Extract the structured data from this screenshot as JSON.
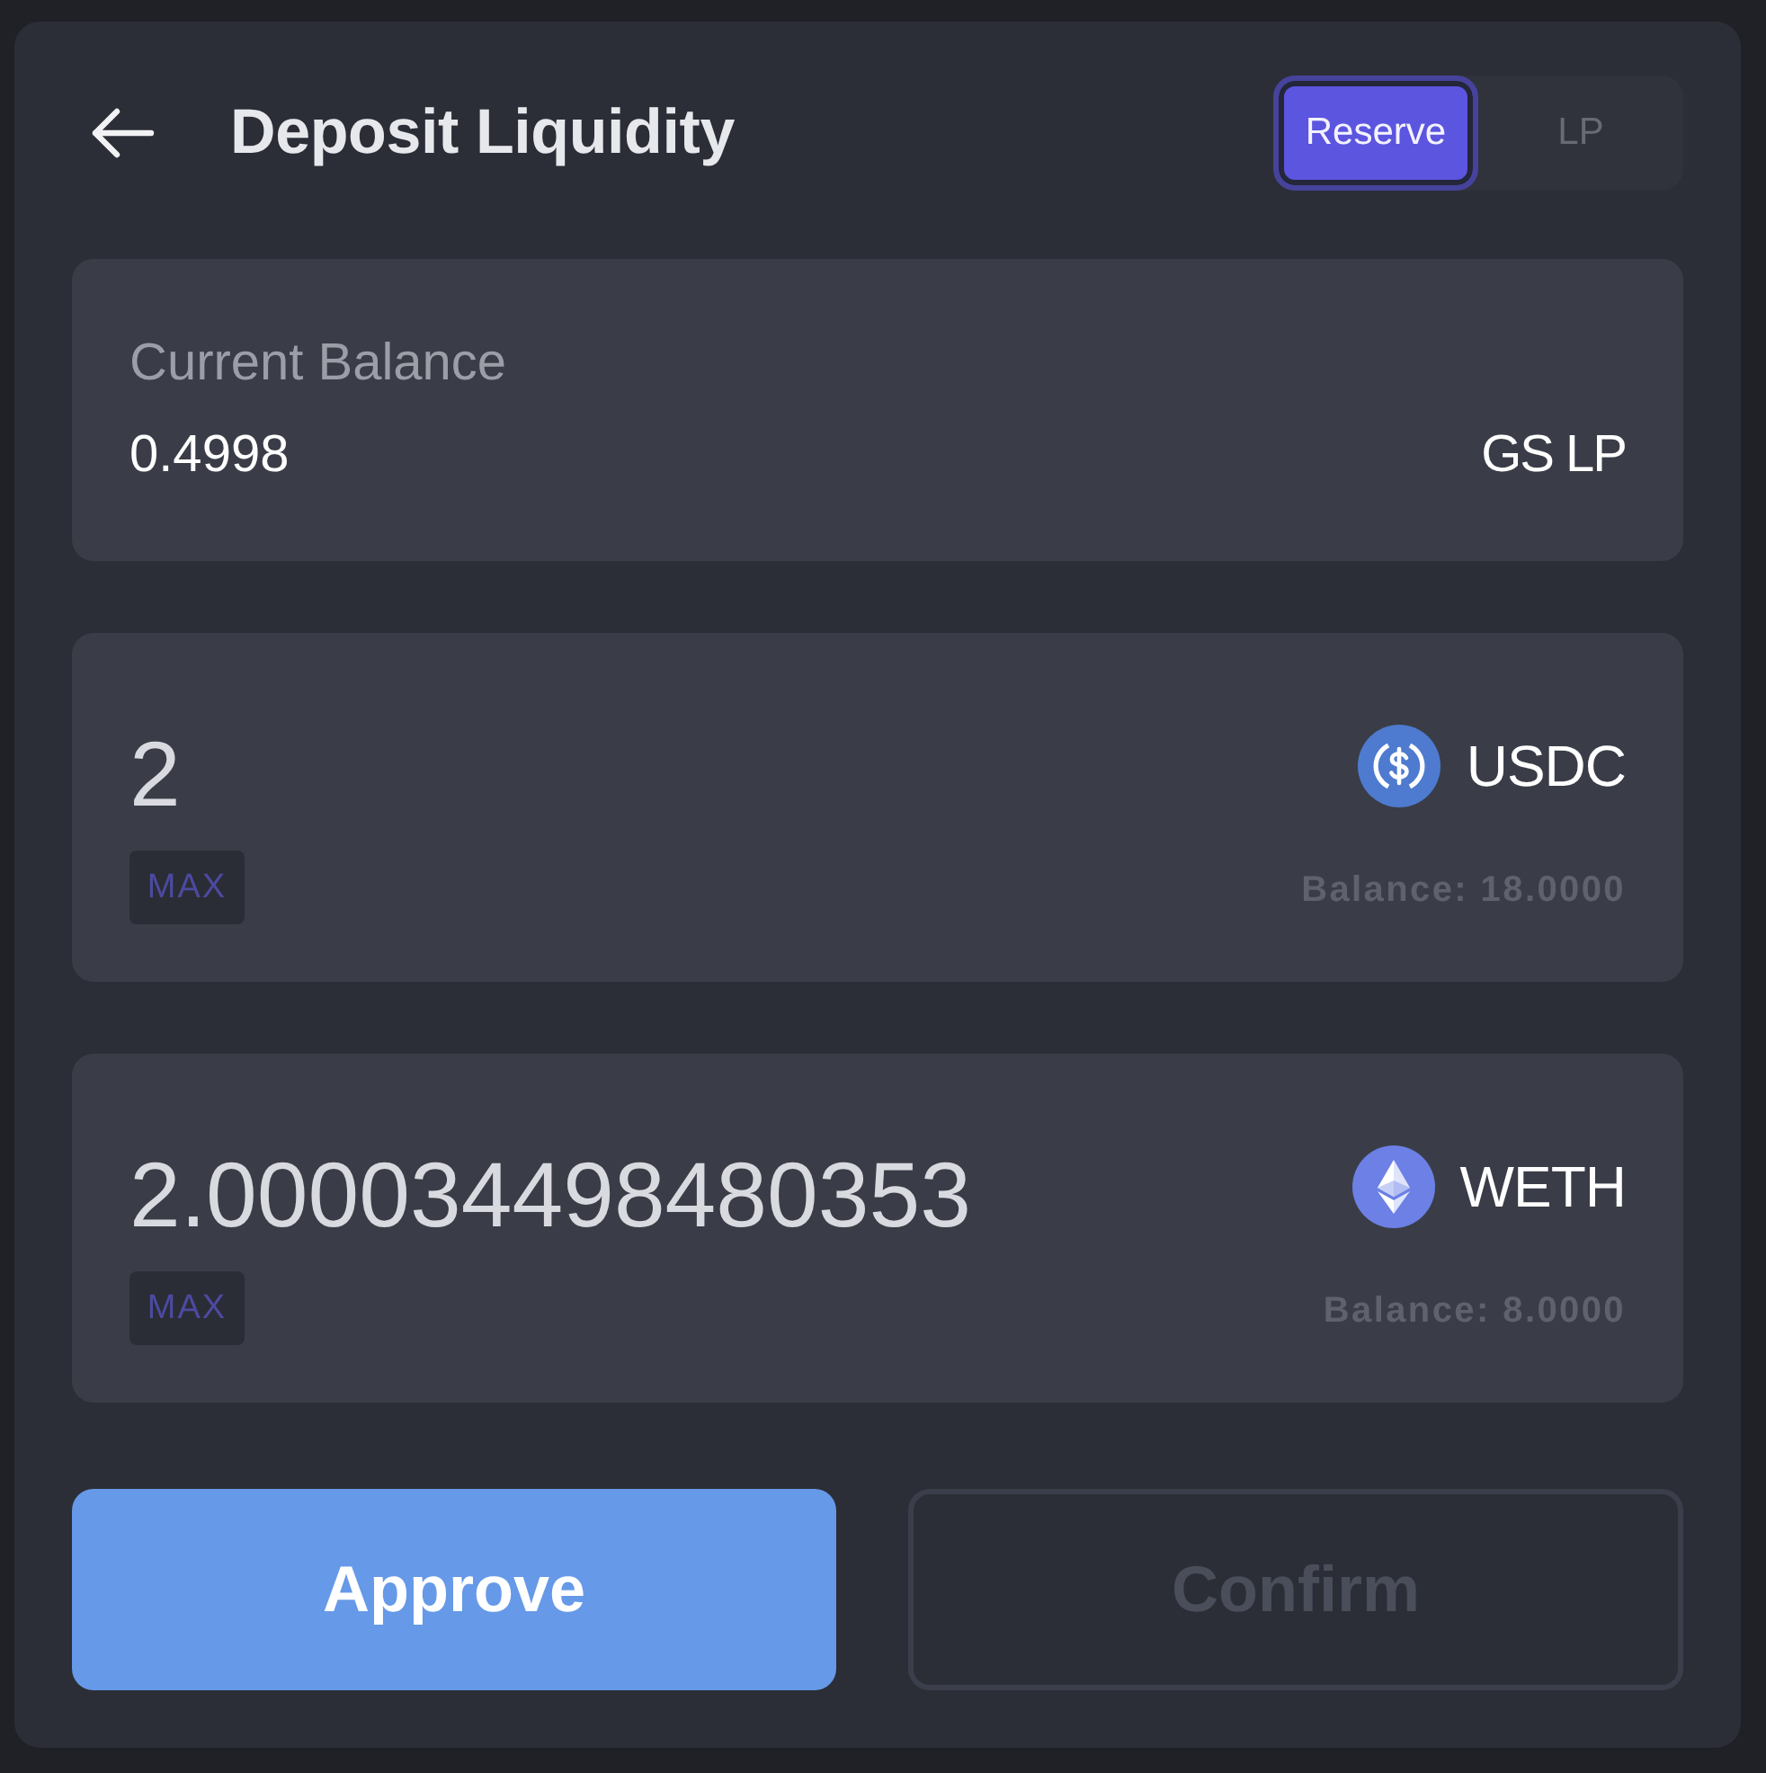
{
  "header": {
    "title": "Deposit Liquidity"
  },
  "mode_tabs": [
    {
      "label": "Reserve",
      "selected": true
    },
    {
      "label": "LP",
      "selected": false
    }
  ],
  "current_balance": {
    "label": "Current Balance",
    "value": "0.4998",
    "unit": "GS LP"
  },
  "inputs": [
    {
      "value": "2",
      "max_label": "MAX",
      "token": "USDC",
      "kind": "usdc",
      "balance": "Balance: 18.0000"
    },
    {
      "value": "2.000034498480353",
      "max_label": "MAX",
      "token": "WETH",
      "kind": "eth",
      "balance": "Balance: 8.0000"
    }
  ],
  "buttons": [
    {
      "label": "Approve",
      "kind": "primary",
      "disabled": false
    },
    {
      "label": "Confirm",
      "kind": "outline",
      "disabled": true
    }
  ]
}
